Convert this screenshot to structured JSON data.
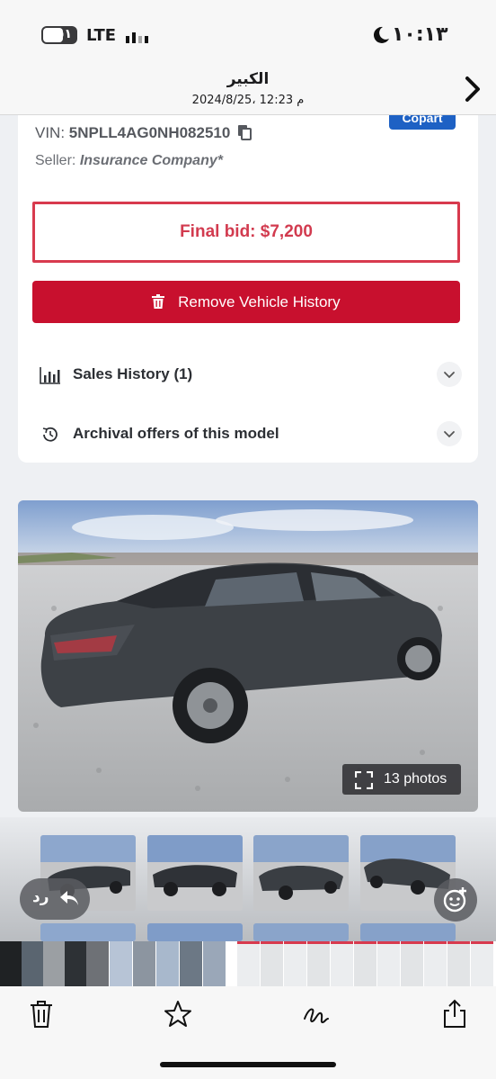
{
  "status_bar": {
    "battery_level": "٥١",
    "network": "LTE",
    "time": "١٠:١٣"
  },
  "viewer": {
    "title": "الكبير",
    "subtitle": "2024/8/25، 12:23 م"
  },
  "listing": {
    "badge": "Copart",
    "vin_label": "VIN:",
    "vin_value": "5NPLL4AG0NH082510",
    "seller_label": "Seller:",
    "seller_value": "Insurance Company*",
    "final_bid": "Final bid: $7,200",
    "remove_button": "Remove Vehicle History",
    "sales_history": "Sales History (1)",
    "archival_offers": "Archival offers of this model",
    "photos_count": "13 photos"
  },
  "overlay": {
    "reply_label": "رد"
  },
  "toolbar": {
    "icons": [
      "trash-icon",
      "star-icon",
      "markup-icon",
      "share-icon"
    ]
  },
  "colors": {
    "accent_red": "#c8102e",
    "bid_border": "#d83a4e",
    "copart_blue": "#1e61c4"
  }
}
